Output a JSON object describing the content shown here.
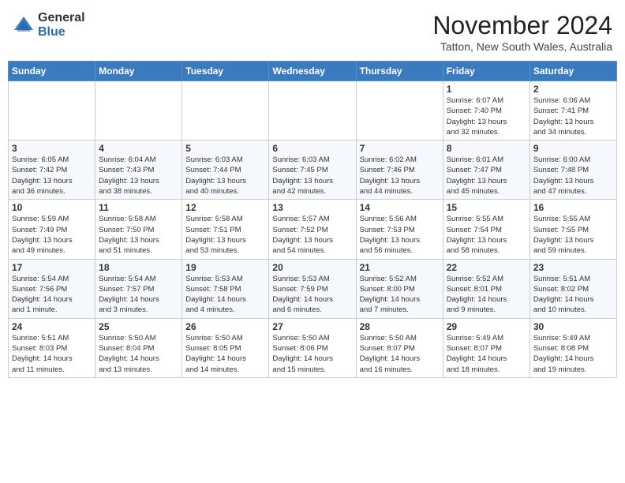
{
  "logo": {
    "general": "General",
    "blue": "Blue"
  },
  "title": "November 2024",
  "location": "Tatton, New South Wales, Australia",
  "weekdays": [
    "Sunday",
    "Monday",
    "Tuesday",
    "Wednesday",
    "Thursday",
    "Friday",
    "Saturday"
  ],
  "weeks": [
    [
      {
        "day": "",
        "info": ""
      },
      {
        "day": "",
        "info": ""
      },
      {
        "day": "",
        "info": ""
      },
      {
        "day": "",
        "info": ""
      },
      {
        "day": "",
        "info": ""
      },
      {
        "day": "1",
        "info": "Sunrise: 6:07 AM\nSunset: 7:40 PM\nDaylight: 13 hours\nand 32 minutes."
      },
      {
        "day": "2",
        "info": "Sunrise: 6:06 AM\nSunset: 7:41 PM\nDaylight: 13 hours\nand 34 minutes."
      }
    ],
    [
      {
        "day": "3",
        "info": "Sunrise: 6:05 AM\nSunset: 7:42 PM\nDaylight: 13 hours\nand 36 minutes."
      },
      {
        "day": "4",
        "info": "Sunrise: 6:04 AM\nSunset: 7:43 PM\nDaylight: 13 hours\nand 38 minutes."
      },
      {
        "day": "5",
        "info": "Sunrise: 6:03 AM\nSunset: 7:44 PM\nDaylight: 13 hours\nand 40 minutes."
      },
      {
        "day": "6",
        "info": "Sunrise: 6:03 AM\nSunset: 7:45 PM\nDaylight: 13 hours\nand 42 minutes."
      },
      {
        "day": "7",
        "info": "Sunrise: 6:02 AM\nSunset: 7:46 PM\nDaylight: 13 hours\nand 44 minutes."
      },
      {
        "day": "8",
        "info": "Sunrise: 6:01 AM\nSunset: 7:47 PM\nDaylight: 13 hours\nand 45 minutes."
      },
      {
        "day": "9",
        "info": "Sunrise: 6:00 AM\nSunset: 7:48 PM\nDaylight: 13 hours\nand 47 minutes."
      }
    ],
    [
      {
        "day": "10",
        "info": "Sunrise: 5:59 AM\nSunset: 7:49 PM\nDaylight: 13 hours\nand 49 minutes."
      },
      {
        "day": "11",
        "info": "Sunrise: 5:58 AM\nSunset: 7:50 PM\nDaylight: 13 hours\nand 51 minutes."
      },
      {
        "day": "12",
        "info": "Sunrise: 5:58 AM\nSunset: 7:51 PM\nDaylight: 13 hours\nand 53 minutes."
      },
      {
        "day": "13",
        "info": "Sunrise: 5:57 AM\nSunset: 7:52 PM\nDaylight: 13 hours\nand 54 minutes."
      },
      {
        "day": "14",
        "info": "Sunrise: 5:56 AM\nSunset: 7:53 PM\nDaylight: 13 hours\nand 56 minutes."
      },
      {
        "day": "15",
        "info": "Sunrise: 5:55 AM\nSunset: 7:54 PM\nDaylight: 13 hours\nand 58 minutes."
      },
      {
        "day": "16",
        "info": "Sunrise: 5:55 AM\nSunset: 7:55 PM\nDaylight: 13 hours\nand 59 minutes."
      }
    ],
    [
      {
        "day": "17",
        "info": "Sunrise: 5:54 AM\nSunset: 7:56 PM\nDaylight: 14 hours\nand 1 minute."
      },
      {
        "day": "18",
        "info": "Sunrise: 5:54 AM\nSunset: 7:57 PM\nDaylight: 14 hours\nand 3 minutes."
      },
      {
        "day": "19",
        "info": "Sunrise: 5:53 AM\nSunset: 7:58 PM\nDaylight: 14 hours\nand 4 minutes."
      },
      {
        "day": "20",
        "info": "Sunrise: 5:53 AM\nSunset: 7:59 PM\nDaylight: 14 hours\nand 6 minutes."
      },
      {
        "day": "21",
        "info": "Sunrise: 5:52 AM\nSunset: 8:00 PM\nDaylight: 14 hours\nand 7 minutes."
      },
      {
        "day": "22",
        "info": "Sunrise: 5:52 AM\nSunset: 8:01 PM\nDaylight: 14 hours\nand 9 minutes."
      },
      {
        "day": "23",
        "info": "Sunrise: 5:51 AM\nSunset: 8:02 PM\nDaylight: 14 hours\nand 10 minutes."
      }
    ],
    [
      {
        "day": "24",
        "info": "Sunrise: 5:51 AM\nSunset: 8:03 PM\nDaylight: 14 hours\nand 11 minutes."
      },
      {
        "day": "25",
        "info": "Sunrise: 5:50 AM\nSunset: 8:04 PM\nDaylight: 14 hours\nand 13 minutes."
      },
      {
        "day": "26",
        "info": "Sunrise: 5:50 AM\nSunset: 8:05 PM\nDaylight: 14 hours\nand 14 minutes."
      },
      {
        "day": "27",
        "info": "Sunrise: 5:50 AM\nSunset: 8:06 PM\nDaylight: 14 hours\nand 15 minutes."
      },
      {
        "day": "28",
        "info": "Sunrise: 5:50 AM\nSunset: 8:07 PM\nDaylight: 14 hours\nand 16 minutes."
      },
      {
        "day": "29",
        "info": "Sunrise: 5:49 AM\nSunset: 8:07 PM\nDaylight: 14 hours\nand 18 minutes."
      },
      {
        "day": "30",
        "info": "Sunrise: 5:49 AM\nSunset: 8:08 PM\nDaylight: 14 hours\nand 19 minutes."
      }
    ]
  ]
}
